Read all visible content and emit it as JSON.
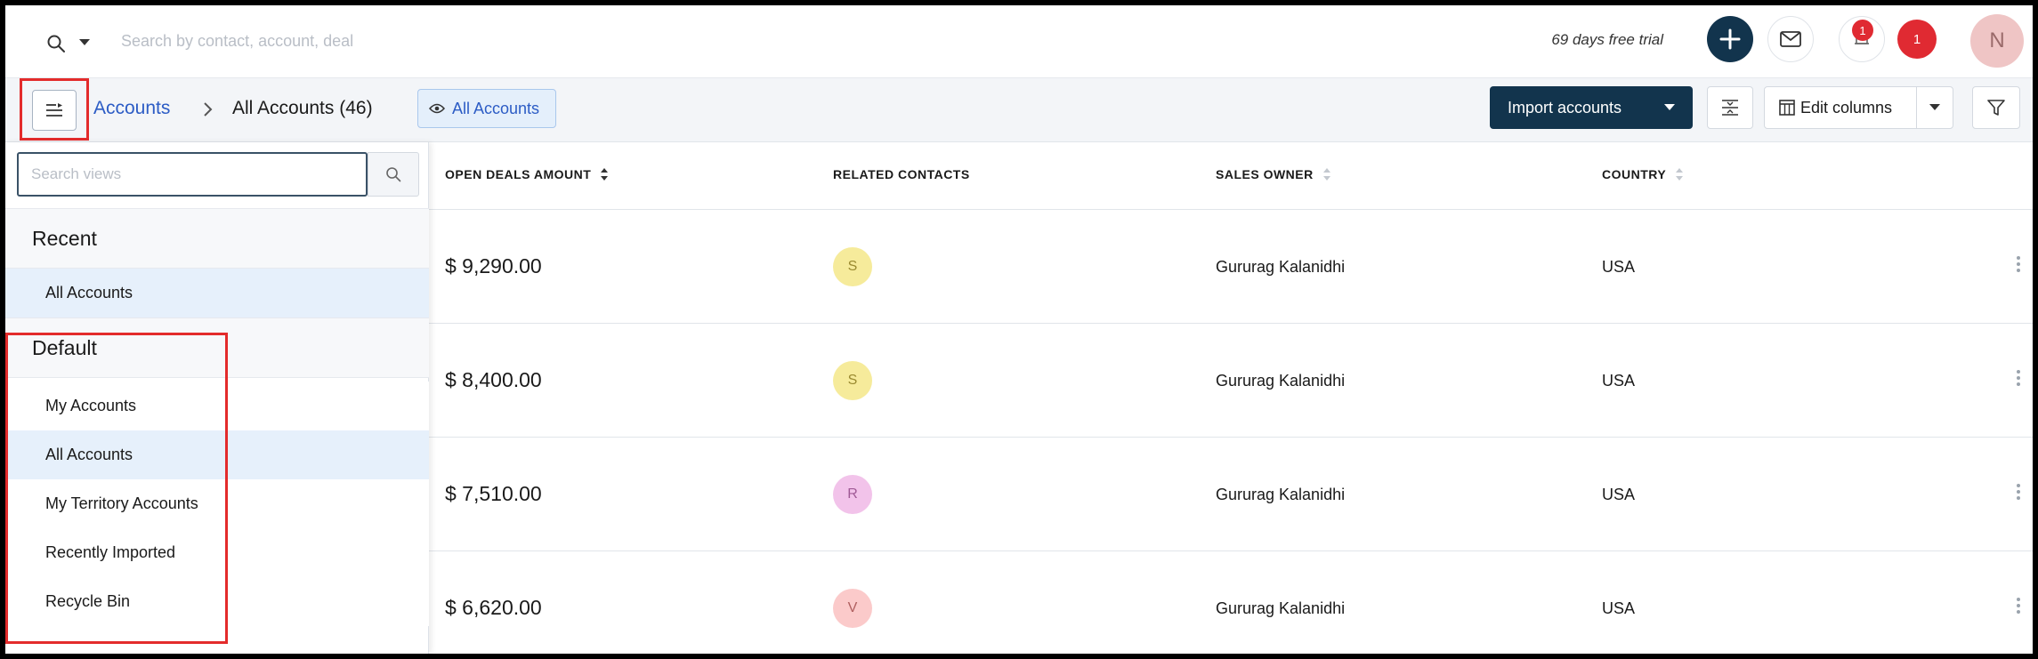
{
  "header": {
    "search_placeholder": "Search by contact, account, deal",
    "trial_text": "69 days free trial",
    "bell_badge": "1",
    "notification_count": "1",
    "avatar_initial": "N"
  },
  "toolbar": {
    "breadcrumb_root": "Accounts",
    "breadcrumb_current": "All Accounts (46)",
    "view_chip": "All Accounts",
    "import_label": "Import accounts",
    "edit_columns_label": "Edit columns"
  },
  "views_panel": {
    "search_placeholder": "Search views",
    "recent_title": "Recent",
    "recent_items": [
      "All Accounts"
    ],
    "default_title": "Default",
    "default_items": [
      "My Accounts",
      "All Accounts",
      "My Territory Accounts",
      "Recently Imported",
      "Recycle Bin"
    ]
  },
  "table": {
    "columns": [
      "OPEN DEALS AMOUNT",
      "RELATED CONTACTS",
      "SALES OWNER",
      "COUNTRY"
    ],
    "rows": [
      {
        "amount": "$ 9,290.00",
        "contact_initial": "S",
        "owner": "Gururag Kalanidhi",
        "country": "USA"
      },
      {
        "amount": "$ 8,400.00",
        "contact_initial": "S",
        "owner": "Gururag Kalanidhi",
        "country": "USA"
      },
      {
        "amount": "$ 7,510.00",
        "contact_initial": "R",
        "owner": "Gururag Kalanidhi",
        "country": "USA"
      },
      {
        "amount": "$ 6,620.00",
        "contact_initial": "V",
        "owner": "Gururag Kalanidhi",
        "country": "USA"
      }
    ]
  },
  "colors": {
    "brand_dark": "#12344d",
    "link_blue": "#2c5cc5",
    "alert_red": "#e02a32",
    "highlight_red": "#e32b2b",
    "avatar_s": "#f6eb9b",
    "avatar_r": "#f2c3ea",
    "avatar_v": "#fbcaca"
  },
  "icons": {
    "search": "search-icon",
    "add": "plus-icon",
    "mail": "mail-icon",
    "bell": "bell-icon",
    "views_toggle": "list-views-icon",
    "eye": "eye-icon",
    "density": "density-icon",
    "columns": "columns-icon",
    "filter": "filter-icon"
  }
}
